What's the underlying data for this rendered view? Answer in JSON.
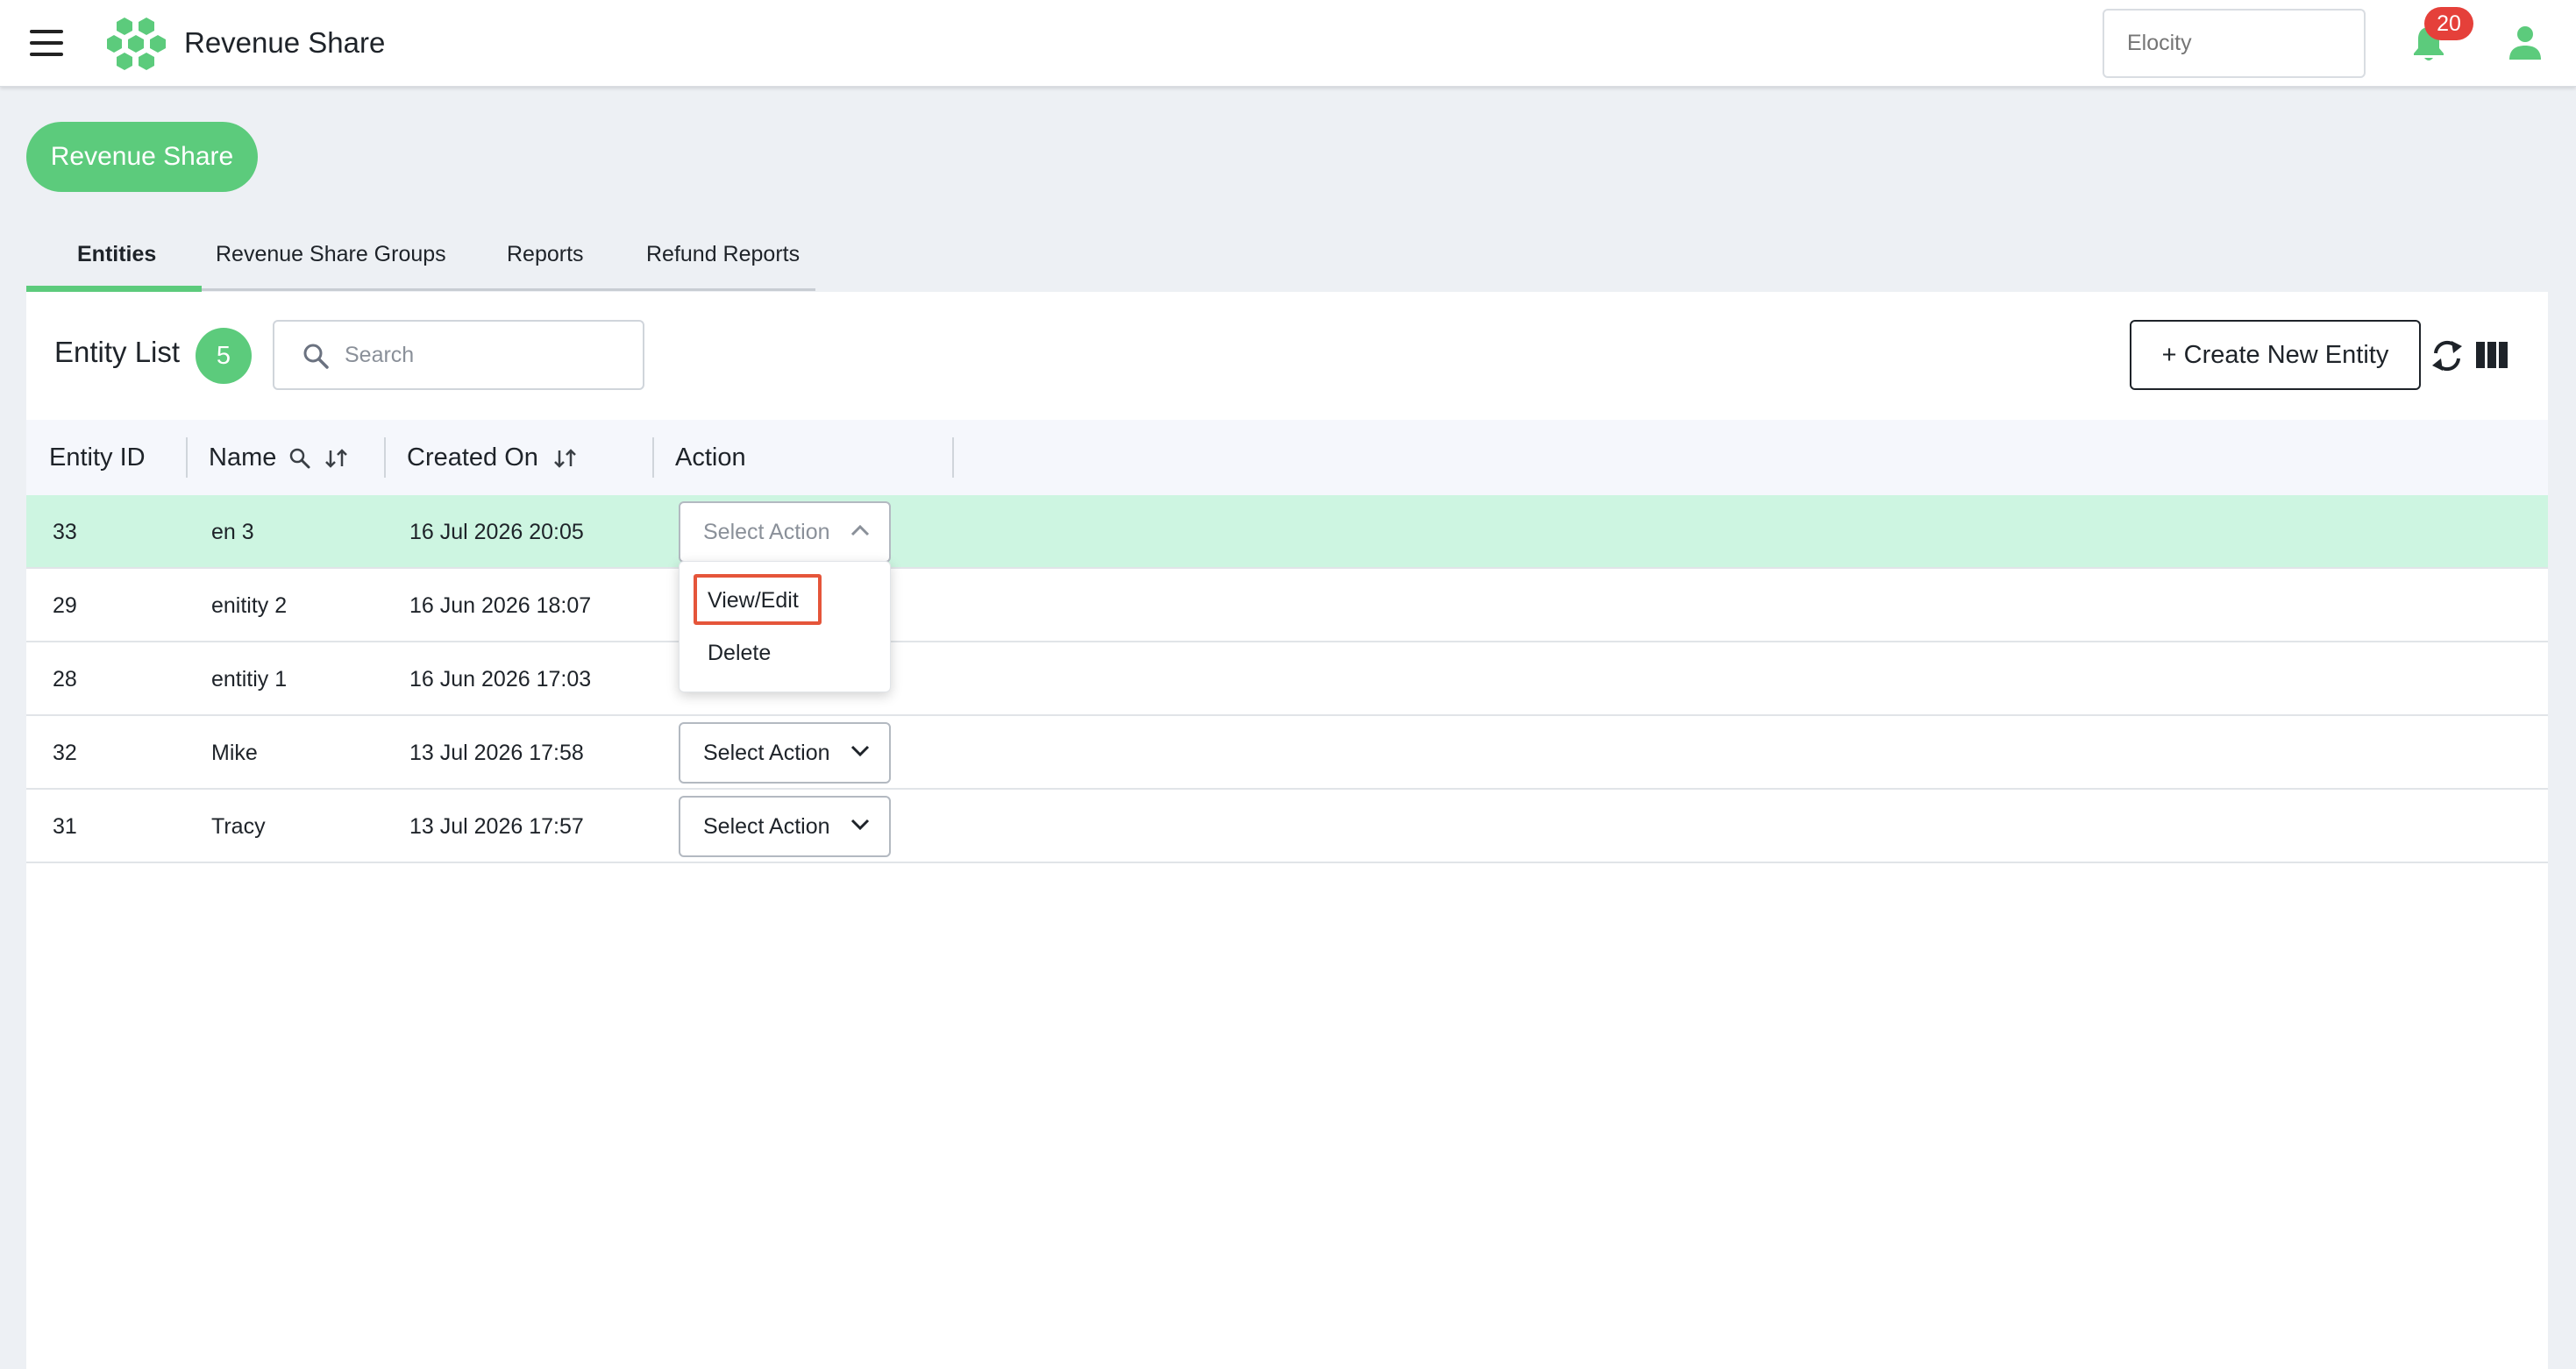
{
  "header": {
    "app_title": "Revenue Share",
    "org_placeholder": "Elocity",
    "notification_count": "20"
  },
  "module": {
    "label": "Revenue Share"
  },
  "tabs": [
    {
      "label": "Entities",
      "active": true
    },
    {
      "label": "Revenue Share Groups",
      "active": false
    },
    {
      "label": "Reports",
      "active": false
    },
    {
      "label": "Refund Reports",
      "active": false
    }
  ],
  "entity_list": {
    "title": "Entity List",
    "count": "5",
    "search_placeholder": "Search",
    "create_label": "+ Create New Entity"
  },
  "table": {
    "columns": [
      "Entity ID",
      "Name",
      "Created On",
      "Action"
    ],
    "rows": [
      {
        "id": "33",
        "name": "en 3",
        "created": "16 Jul 2026 20:05",
        "action": "Select Action",
        "highlighted": true,
        "open": true
      },
      {
        "id": "29",
        "name": "enitity 2",
        "created": "16 Jun 2026 18:07",
        "action": "Select Action"
      },
      {
        "id": "28",
        "name": "entitiy 1",
        "created": "16 Jun 2026 17:03",
        "action": "Select Action"
      },
      {
        "id": "32",
        "name": "Mike",
        "created": "13 Jul 2026 17:58",
        "action": "Select Action"
      },
      {
        "id": "31",
        "name": "Tracy",
        "created": "13 Jul 2026 17:57",
        "action": "Select Action"
      }
    ]
  },
  "action_menu": {
    "items": [
      "View/Edit",
      "Delete"
    ]
  },
  "colors": {
    "accent_green": "#5ccb7c",
    "row_highlight": "#cdf5e1",
    "badge_red": "#e5403a",
    "annotation_red": "#e5553a"
  }
}
